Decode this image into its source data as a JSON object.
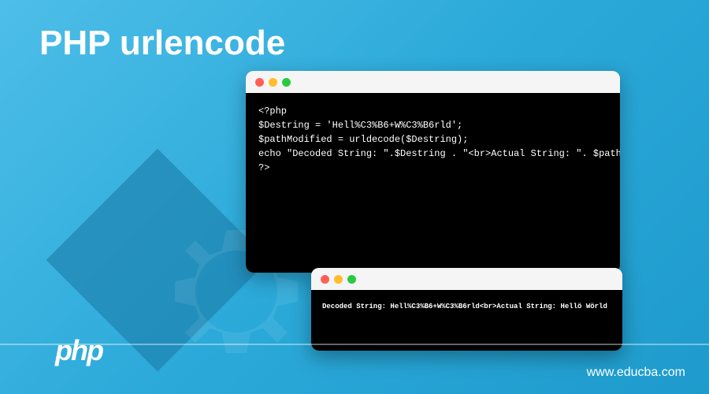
{
  "title": "PHP urlencode",
  "code1": {
    "lines": [
      "<?php",
      "$Destring = 'Hell%C3%B6+W%C3%B6rld';",
      "$pathModified = urldecode($Destring);",
      "echo \"Decoded String: \".$Destring . \"<br>Actual String: \". $pathModified;",
      "?>"
    ]
  },
  "code2": {
    "lines": [
      "Decoded String: Hell%C3%B6+W%C3%B6rld<br>Actual String: Hellö Wörld"
    ]
  },
  "website": "www.educba.com",
  "logo": "php"
}
